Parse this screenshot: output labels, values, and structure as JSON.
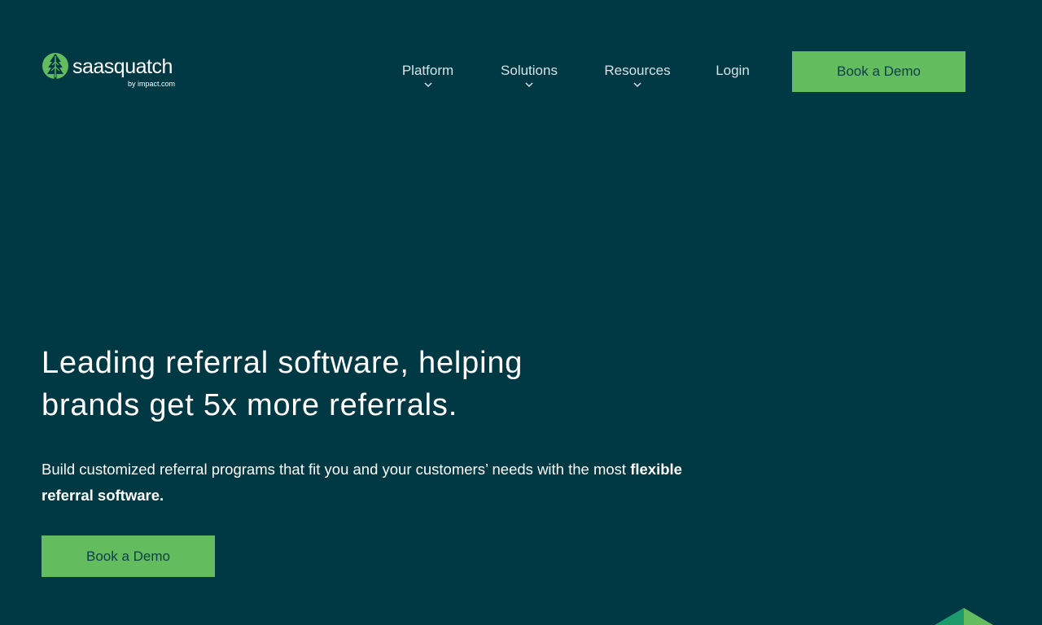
{
  "header": {
    "logo": {
      "wordmark": "saasquatch",
      "byline": "by impact.com"
    },
    "nav": [
      {
        "label": "Platform",
        "has_dropdown": true
      },
      {
        "label": "Solutions",
        "has_dropdown": true
      },
      {
        "label": "Resources",
        "has_dropdown": true
      },
      {
        "label": "Login",
        "has_dropdown": false
      }
    ],
    "cta_label": "Book a Demo"
  },
  "hero": {
    "title_line1": "Leading referral software, helping",
    "title_line2": "brands get 5x more referrals.",
    "subtitle_part1": "Build customized referral programs that fit you and your customers’ needs with the most ",
    "subtitle_bold": "flexible referral software.",
    "cta_label": "Book a Demo"
  },
  "colors": {
    "background": "#003843",
    "accent_green": "#63bc5d",
    "button_text": "#0d4048",
    "nav_text": "#d7e3e6"
  },
  "icons": {
    "logo": "tree-logo-icon",
    "dropdown": "chevron-down-icon",
    "decoration": "tree-shape-icon"
  }
}
